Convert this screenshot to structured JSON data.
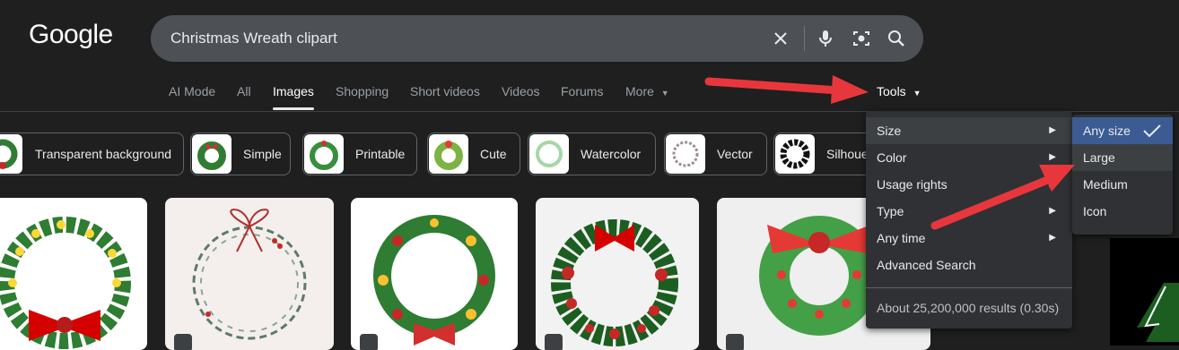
{
  "logo": "Google",
  "search": {
    "query": "Christmas Wreath clipart"
  },
  "tabs": [
    {
      "label": "AI Mode"
    },
    {
      "label": "All"
    },
    {
      "label": "Images"
    },
    {
      "label": "Shopping"
    },
    {
      "label": "Short videos"
    },
    {
      "label": "Videos"
    },
    {
      "label": "Forums"
    },
    {
      "label": "More"
    }
  ],
  "tools_label": "Tools",
  "chips": [
    {
      "label": "Transparent background"
    },
    {
      "label": "Simple"
    },
    {
      "label": "Printable"
    },
    {
      "label": "Cute"
    },
    {
      "label": "Watercolor"
    },
    {
      "label": "Vector"
    },
    {
      "label": "Silhouette"
    }
  ],
  "tools_menu": {
    "items": [
      {
        "label": "Size"
      },
      {
        "label": "Color"
      },
      {
        "label": "Usage rights"
      },
      {
        "label": "Type"
      },
      {
        "label": "Any time"
      },
      {
        "label": "Advanced Search"
      }
    ],
    "results": "About 25,200,000 results (0.30s)"
  },
  "size_submenu": {
    "items": [
      {
        "label": "Any size"
      },
      {
        "label": "Large"
      },
      {
        "label": "Medium"
      },
      {
        "label": "Icon"
      }
    ]
  },
  "colors": {
    "accent_arrow": "#e8373c",
    "selected": "#3b5b92"
  }
}
